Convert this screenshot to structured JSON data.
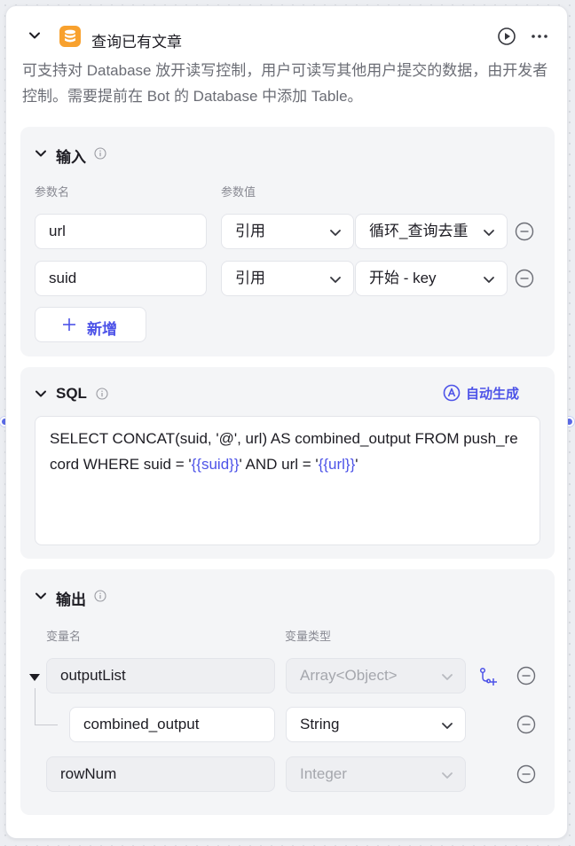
{
  "node": {
    "title": "查询已有文章",
    "description": "可支持对 Database 放开读写控制，用户可读写其他用户提交的数据，由开发者控制。需要提前在 Bot 的 Database 中添加 Table。"
  },
  "input": {
    "title": "输入",
    "col_name": "参数名",
    "col_value": "参数值",
    "rows": [
      {
        "name": "url",
        "type": "引用",
        "value": "循环_查询去重"
      },
      {
        "name": "suid",
        "type": "引用",
        "value": "开始 - key"
      }
    ],
    "add_label": "新增"
  },
  "sql": {
    "title": "SQL",
    "auto_label": "自动生成",
    "part1": "SELECT CONCAT(suid, '@', url) AS combined_output FROM push_record WHERE suid = '",
    "var1": "{{suid}}",
    "part2": "' AND url = '",
    "var2": "{{url}}",
    "part3": "'"
  },
  "output": {
    "title": "输出",
    "col_name": "变量名",
    "col_type": "变量类型",
    "rows": [
      {
        "name": "outputList",
        "type": "Array<Object>"
      },
      {
        "name": "combined_output",
        "type": "String"
      },
      {
        "name": "rowNum",
        "type": "Integer"
      }
    ]
  },
  "colors": {
    "accent": "#4d53e8",
    "db_icon": "#f8a12e",
    "port": "#5b6be8"
  },
  "icons": {
    "header_collapse": "chevron-down-icon",
    "db": "database-icon",
    "run": "play-circle-icon",
    "more": "more-icon",
    "info": "info-icon",
    "remove": "minus-circle-icon",
    "add": "plus-icon",
    "auto": "ai-icon",
    "add_child": "add-child-icon"
  }
}
